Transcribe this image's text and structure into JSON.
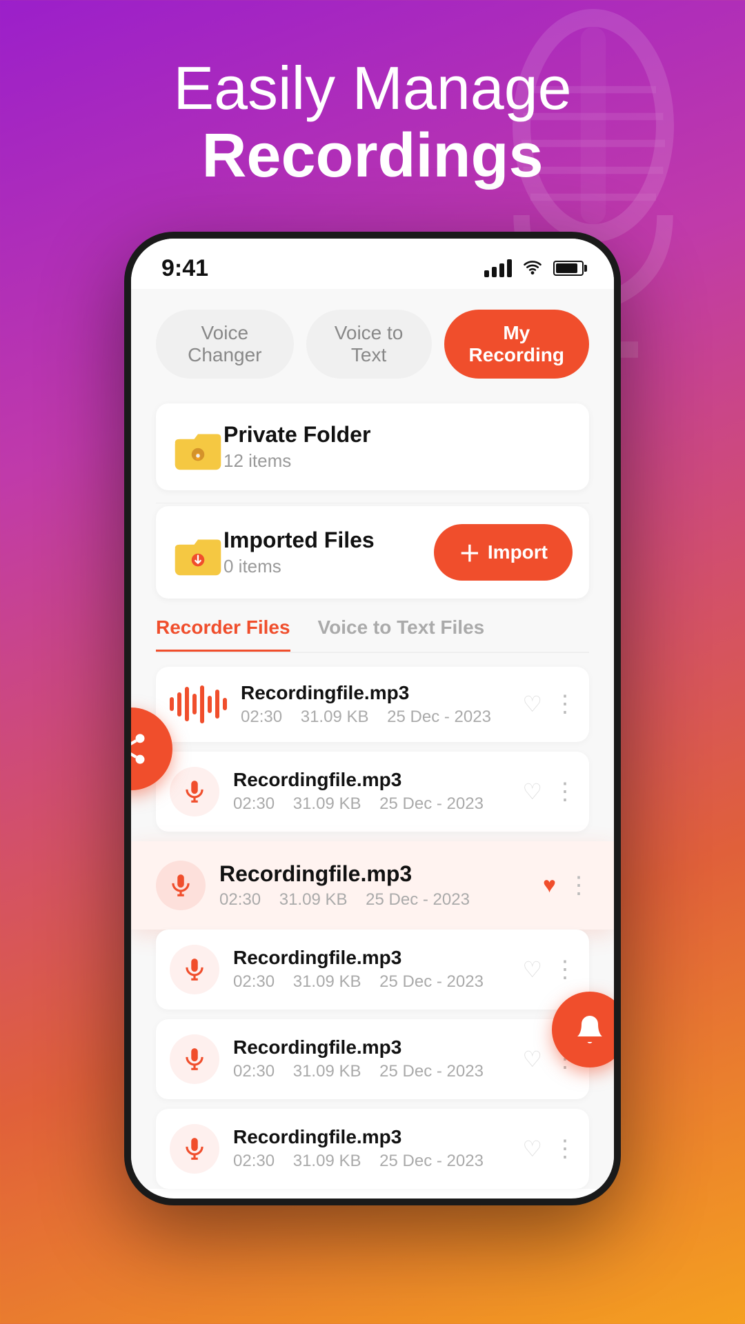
{
  "header": {
    "title_light": "Easily Manage",
    "title_bold": "Recordings"
  },
  "status_bar": {
    "time": "9:41"
  },
  "tabs": [
    {
      "id": "voice-changer",
      "label": "Voice Changer",
      "active": false
    },
    {
      "id": "voice-to-text",
      "label": "Voice to Text",
      "active": false
    },
    {
      "id": "my-recording",
      "label": "My Recording",
      "active": true
    }
  ],
  "folders": [
    {
      "id": "private-folder",
      "name": "Private Folder",
      "count": "12 items",
      "has_import": false
    },
    {
      "id": "imported-files",
      "name": "Imported Files",
      "count": "0 items",
      "has_import": true,
      "import_label": "Import"
    }
  ],
  "file_tabs": [
    {
      "label": "Recorder Files",
      "active": true
    },
    {
      "label": "Voice to Text Files",
      "active": false
    }
  ],
  "recordings": [
    {
      "id": "rec1",
      "name": "Recordingfile.mp3",
      "duration": "02:30",
      "size": "31.09 KB",
      "date": "25 Dec - 2023",
      "favorited": false,
      "wave": true
    },
    {
      "id": "rec2",
      "name": "Recordingfile.mp3",
      "duration": "02:30",
      "size": "31.09 KB",
      "date": "25 Dec - 2023",
      "favorited": false,
      "wave": false
    },
    {
      "id": "rec3",
      "name": "Recordingfile.mp3",
      "duration": "02:30",
      "size": "31.09 KB",
      "date": "25 Dec - 2023",
      "favorited": true,
      "highlighted": true
    },
    {
      "id": "rec4",
      "name": "Recordingfile.mp3",
      "duration": "02:30",
      "size": "31.09 KB",
      "date": "25 Dec - 2023",
      "favorited": false
    },
    {
      "id": "rec5",
      "name": "Recordingfile.mp3",
      "duration": "02:30",
      "size": "31.09 KB",
      "date": "25 Dec - 2023",
      "favorited": false
    },
    {
      "id": "rec6",
      "name": "Recordingfile.mp3",
      "duration": "02:30",
      "size": "31.09 KB",
      "date": "25 Dec - 2023",
      "favorited": false
    }
  ],
  "colors": {
    "accent": "#f04e2c",
    "bg_gradient_start": "#9b1fca",
    "bg_gradient_end": "#f5a020"
  }
}
